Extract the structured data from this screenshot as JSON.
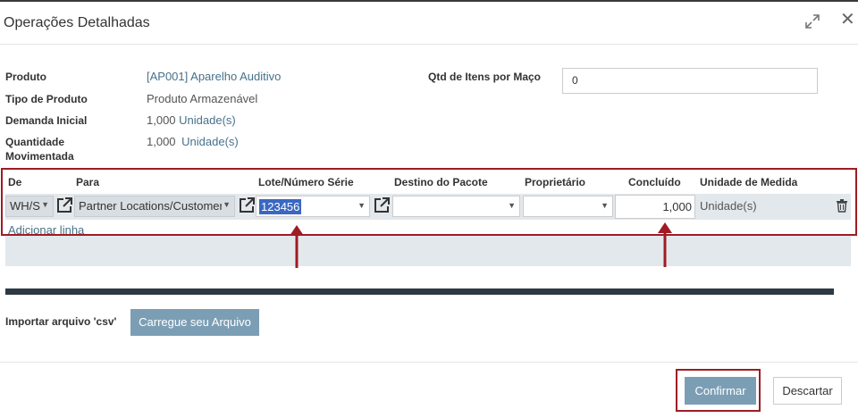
{
  "header": {
    "title": "Operações Detalhadas"
  },
  "form": {
    "produto_label": "Produto",
    "produto_value": "[AP001] Aparelho Auditivo",
    "tipo_label": "Tipo de Produto",
    "tipo_value": "Produto Armazenável",
    "demanda_label": "Demanda Inicial",
    "demanda_qty": "1,000",
    "demanda_uom": "Unidade(s)",
    "quantidade_label": "Quantidade Movimentada",
    "quantidade_qty": "1,000",
    "quantidade_uom": "Unidade(s)",
    "qtd_label": "Qtd de Itens por Maço",
    "qtd_value": "0"
  },
  "table": {
    "columns": {
      "de": "De",
      "para": "Para",
      "lote": "Lote/Número Série",
      "destino": "Destino do Pacote",
      "proprietario": "Proprietário",
      "concluido": "Concluído",
      "uom": "Unidade de Medida"
    },
    "row": {
      "de": "WH/S",
      "para": "Partner Locations/Customers",
      "lote": "123456",
      "destino": "",
      "proprietario": "",
      "concluido": "1,000",
      "uom": "Unidade(s)"
    },
    "add_line": "Adicionar linha"
  },
  "import": {
    "label": "Importar arquivo 'csv'",
    "button": "Carregue seu Arquivo"
  },
  "footer": {
    "confirm": "Confirmar",
    "discard": "Descartar"
  },
  "colors": {
    "accent": "#7c9eb5",
    "link": "#47718a",
    "highlight_frame": "#9e1c24",
    "dark_bar": "#2d3a44"
  },
  "icons": {
    "expand": "expand-icon",
    "close": "close-icon",
    "external_link": "external-link-icon",
    "trash": "trash-icon",
    "arrow": "arrow-up-icon"
  }
}
